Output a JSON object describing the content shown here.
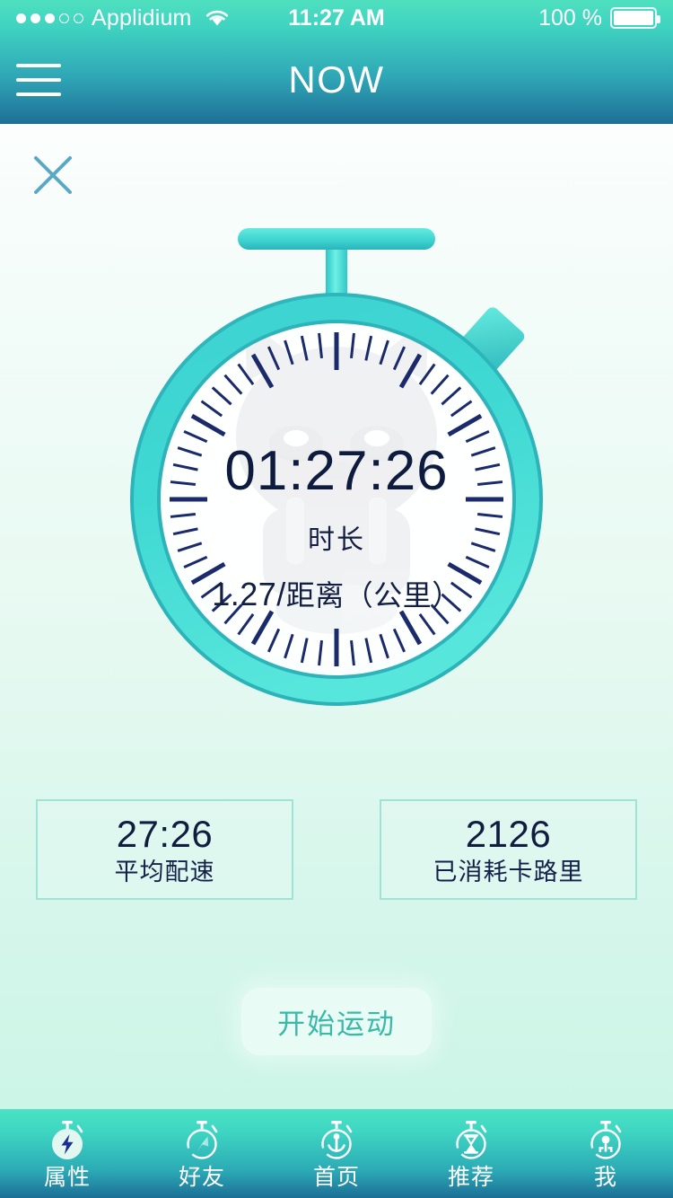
{
  "status_bar": {
    "carrier": "Applidium",
    "signal_dots_filled": 3,
    "signal_dots_total": 5,
    "wifi_icon": "wifi-icon",
    "time": "11:27 AM",
    "battery_percent": "100 %",
    "battery_icon": "battery-full-icon"
  },
  "navbar": {
    "menu_icon": "hamburger-menu-icon",
    "title": "NOW"
  },
  "content": {
    "close_icon": "close-icon",
    "stopwatch": {
      "icon": "stopwatch-icon",
      "time": "01:27:26",
      "time_label": "时长",
      "distance_value": "1.27/",
      "distance_label": "距离（公里）",
      "watermark": "cat-mascot-watermark"
    },
    "stats": [
      {
        "value": "27:26",
        "label": "平均配速",
        "name": "average-pace"
      },
      {
        "value": "2126",
        "label": "已消耗卡路里",
        "name": "calories-burned"
      }
    ],
    "start_button": "开始运动"
  },
  "tabbar": {
    "items": [
      {
        "label": "属性",
        "icon": "bolt-stopwatch-icon",
        "active": true
      },
      {
        "label": "好友",
        "icon": "compass-stopwatch-icon",
        "active": false
      },
      {
        "label": "首页",
        "icon": "anchor-stopwatch-icon",
        "active": false
      },
      {
        "label": "推荐",
        "icon": "hourglass-stopwatch-icon",
        "active": false
      },
      {
        "label": "我",
        "icon": "person-stopwatch-icon",
        "active": false
      }
    ]
  },
  "colors": {
    "header_top": "#4fe0bf",
    "header_bottom": "#1e6f96",
    "bezel": "#3fd5cf",
    "bezel_shadow": "#2fb7b8",
    "tick": "#1b2a6b",
    "text_dark": "#0d1b3e",
    "accent_teal": "#3ab9a8",
    "stat_border": "#9fe3d4"
  }
}
